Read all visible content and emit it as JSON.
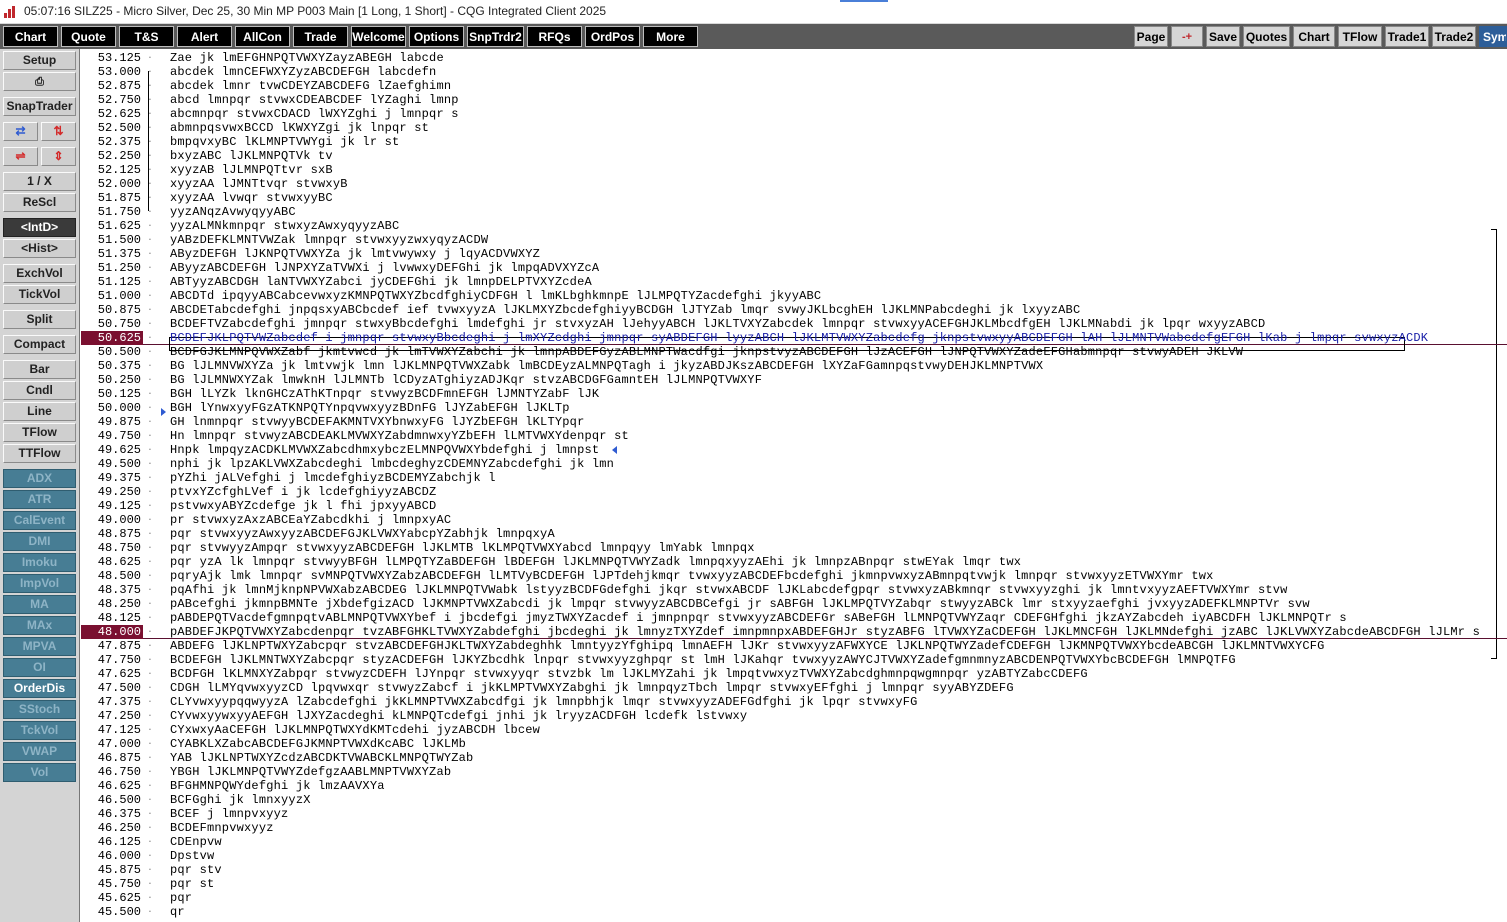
{
  "titlebar": {
    "title": "05:07:16   SILZ25 - Micro Silver, Dec 25, 30 Min MP   P003 Main   [1 Long, 1 Short] - CQG Integrated Client 2025"
  },
  "toolbar": {
    "left": [
      "Chart",
      "Quote",
      "T&S",
      "Alert",
      "AllCon",
      "Trade",
      "Welcome",
      "Options",
      "SnpTrdr2",
      "RFQs",
      "OrdPos",
      "More"
    ],
    "right": [
      "Page",
      "-+",
      "Save",
      "Quotes",
      "Chart",
      "TFlow",
      "Trade1",
      "Trade2",
      "Sym"
    ]
  },
  "sidebar": {
    "setup": "Setup",
    "print_icon": "printer-icon",
    "snaptrader": "SnapTrader",
    "one_over_x": "1 / X",
    "rescl": "ReScl",
    "intd": "<IntD>",
    "hist": "<Hist>",
    "exchvol": "ExchVol",
    "tickvol": "TickVol",
    "split": "Split",
    "compact": "Compact",
    "bar": "Bar",
    "cndl": "Cndl",
    "line": "Line",
    "tflow": "TFlow",
    "ttflow": "TTFlow",
    "studies": [
      "ADX",
      "ATR",
      "CalEvent",
      "DMI",
      "Imoku",
      "ImpVol",
      "MA",
      "MAx",
      "MPVA",
      "OI",
      "OrderDis",
      "SStoch",
      "TckVol",
      "VWAP",
      "Vol"
    ],
    "active_study": "OrderDis"
  },
  "colors": {
    "toolbar_bg": "#5a5a5a",
    "highlight_price": "#7a1030",
    "profile_blue": "#1a20a8",
    "study_teal": "#477d94"
  },
  "ladder": {
    "highlighted_prices": [
      "50.625",
      "48.000"
    ],
    "rows": [
      {
        "p": "53.125",
        "t": "Zae jk lmEFGHNPQTVWXYZayzABEGH labcde"
      },
      {
        "p": "53.000",
        "t": "abcdek lmnCEFWXYZyzABCDEFGH labcdefn"
      },
      {
        "p": "52.875",
        "t": "abcdek lmnr tvwCDEYZABCDEFG lZaefghimn"
      },
      {
        "p": "52.750",
        "t": "abcd lmnpqr stvwxCDEABCDEF lYZaghi lmnp"
      },
      {
        "p": "52.625",
        "t": "abcmnpqr stvwxCDACD lWXYZghi j lmnpqr s"
      },
      {
        "p": "52.500",
        "t": "abmnpqsvwxBCCD lKWXYZgi jk lnpqr st"
      },
      {
        "p": "52.375",
        "t": "bmpqvxyBC lKLMNPTVWYgi jk lr st"
      },
      {
        "p": "52.250",
        "t": "bxyzABC lJKLMNPQTVk tv"
      },
      {
        "p": "52.125",
        "t": "xyyzAB lJLMNPQTtvr sxB"
      },
      {
        "p": "52.000",
        "t": "xyyzAA lJMNTtvqr stvwxyB"
      },
      {
        "p": "51.875",
        "t": "xyyzAA lvwqr stvwxyyBC"
      },
      {
        "p": "51.750",
        "t": "yyzANqzAvwyqyyABC"
      },
      {
        "p": "51.625",
        "t": "yyzALMNkmnpqr stwxyzAwxyqyyzABC"
      },
      {
        "p": "51.500",
        "t": "yABzDEFKLMNTVWZak lmnpqr stvwxyyzwxyqyzACDW"
      },
      {
        "p": "51.375",
        "t": "AByzDEFGH lJKNPQTVWXYZa jk lmtvwywxy j lqyACDVWXYZ"
      },
      {
        "p": "51.250",
        "t": "AByyzABCDEFGH lJNPXYZaTVWXi j lvwwxyDEFGhi jk lmpqADVXYZcA"
      },
      {
        "p": "51.125",
        "t": "ABTyyzABCDGH laNTVWXYZabci jyCDEFGhi jk lmnpDELPTVXYZcdeA"
      },
      {
        "p": "51.000",
        "t": "ABCDTd ipqyyABCabcevwxyzKMNPQTWXYZbcdfghiyCDFGH l lmKLbghkmnpE lJLMPQTYZacdefghi jkyyABC"
      },
      {
        "p": "50.875",
        "t": "ABCDETabcdefghi jnpqsxyABCbcdef ief tvwxyyzA lJKLMXYZbcdefghiyyBCDGH lJTYZab lmqr svwyJKLbcghEH lJKLMNPabcdeghi jk lxyyzABC"
      },
      {
        "p": "50.750",
        "t": "BCDEFTVZabcdefghi jmnpqr stwxyBbcdefghi lmdefghi jr stvxyzAH lJehyyABCH lJKLTVXYZabcdek lmnpqr stvwxyyACEFGHJKLMbcdfgEH lJKLMNabdi jk lpqr wxyyzABCD"
      },
      {
        "p": "50.625",
        "t": "BCDEFJKLPQTVWZabcdef i jmnpqr stvwxyBbcdeghi j lmXYZcdghi jmnpqr syABDEFGH lyyzABCH lJKLMTVWXYZabcdefg jknpstvwxyyABCDEFGH lAH lJLMNTVWabcdefgEFGH lKab j lmpqr svwxyzACDK",
        "blue": true
      },
      {
        "p": "50.500",
        "t": "BCDFGJKLMNPQVWXZabf jkmtvwcd jk lmTVWXYZabchi jk lmnpABDEFGyzABLMNPTWacdfgi jknpstvyzABCDEFGH lJzACEFGH lJNPQTVWXYZadeEFGHabmnpqr stvwyADEH JKLVW"
      },
      {
        "p": "50.375",
        "t": "BG lJLMNVWXYZa jk lmtvwjk lmn lJKLMNPQTVWXZabk lmBCDEyzALMNPQTagh i jkyzABDJKszABCDEFGH lXYZaFGamnpqstvwyDEHJKLMNPTVWX"
      },
      {
        "p": "50.250",
        "t": "BG lJLMNWXYZak lmwknH lJLMNTb lCDyzATghiyzADJKqr stvzABCDGFGamntEH lJLMNPQTVWXYF"
      },
      {
        "p": "50.125",
        "t": "BGH lLYZk lknGHCzAThKTnpqr stvwyzBCDFmnEFGH lJMNTYZabF lJK"
      },
      {
        "p": "50.000",
        "t": "BGH lYnwxyyFGzATKNPQTYnpqvwxyyzBDnFG lJYZabEFGH lJKLTp"
      },
      {
        "p": "49.875",
        "t": "GH lnmnpqr stvwyyBCDEFAKMNTVXYbnwxyFG lJYZbEFGH lKLTYpqr"
      },
      {
        "p": "49.750",
        "t": "Hn lmnpqr stvwyzABCDEAKLMVWXYZabdmnwxyYZbEFH lLMTVWXYdenpqr st"
      },
      {
        "p": "49.625",
        "t": "Hnpk lmpqyzACDKLMVWXZabcdhmxybczELMNPQVWXYbdefghi j lmnpst"
      },
      {
        "p": "49.500",
        "t": "nphi jk lpzAKLVWXZabcdeghi lmbcdeghyzCDEMNYZabcdefghi jk lmn"
      },
      {
        "p": "49.375",
        "t": "pYZhi jALVefghi j lmcdefghiyzBCDEMYZabchjk l"
      },
      {
        "p": "49.250",
        "t": "ptvxYZcfghLVef i jk lcdefghiyyzABCDZ"
      },
      {
        "p": "49.125",
        "t": "pstvwxyABYZcdefge jk l fhi jpxyyABCD"
      },
      {
        "p": "49.000",
        "t": "pr stvwxyzAxzABCEaYZabcdkhi j lmnpxyAC"
      },
      {
        "p": "48.875",
        "t": "pqr stvwxyyzAwxyyzABCDEFGJKLVWXYabcpYZabhjk lmnpqxyA"
      },
      {
        "p": "48.750",
        "t": "pqr stvwyyzAmpqr stvwxyyzABCDEFGH lJKLMTB lKLMPQTVWXYabcd lmnpqyy lmYabk lmnpqx"
      },
      {
        "p": "48.625",
        "t": "pqr yzA lk lmnpqr stvwyyBFGH lLMPQTYZaBDEFGH lBDEFGH lJKLMNPQTVWYZadk lmnpqxyyzAEhi jk lmnpzABnpqr stwEYak lmqr twx"
      },
      {
        "p": "48.500",
        "t": "pqryAjk lmk lmnpqr svMNPQTVWXYZabzABCDEFGH lLMTVyBCDEFGH lJPTdehjkmqr tvwxyyzABCDEFbcdefghi jkmnpvwxyzABmnpqtvwjk lmnpqr stvwxyyzETVWXYmr twx"
      },
      {
        "p": "48.375",
        "t": "pqAfhi jk lmnMjknpNPVWXabzABCDEG lJKLMNPQTVWabk lstyyzBCDFGdefghi jkqr stvwxABCDF lJKLabcdefgpqr stvwxyzABkmnqr stvwxyyzghi jk lmntvxyyzAEFTVWXYmr stvw"
      },
      {
        "p": "48.250",
        "t": "pABcefghi jkmnpBMNTe jXbdefgizACD lJKMNPTVWXZabcdi jk lmpqr stvwyyzABCDBCefgi jr sABFGH lJKLMPQTVYZabqr stwyyzABCk lmr stxyyzaefghi jvxyyzADEFKLMNPTVr svw"
      },
      {
        "p": "48.125",
        "t": "pABDEPQTVacdefgmnpqtvABLMNPQTVWXYbef i jbcdefgi jmyzTWXYZacdef i jmnpnpqr stvwxyyzABCDEFGr sABeFGH lLMNPQTVWYZaqr CDEFGHfghi jkzAYZabcdeh iyABCDFH lJKLMNPQTr s"
      },
      {
        "p": "48.000",
        "t": "pABDEFJKPQTVWXYZabcdenpqr tvzABFGHKLTVWXYZabdefghi jbcdeghi jk lmnyzTXYZdef imnpmnpxABDEFGHJr styzABFG lTVWXYZaCDEFGH lJKLMNCFGH lJKLMNdefghi jzABC lJKLVWXYZabcdeABCDFGH lJLMr s"
      },
      {
        "p": "47.875",
        "t": "ABDEFG lJKLNPTWXYZabcpqr stvzABCDEFGHJKLTWXYZabdeghhk lmntyyzYfghipq lmnAEFH lJKr stvwxyyzAFWXYCE lJKLNPQTWYZadefCDEFGH lJKMNPQTVWXYbcdeABCGH lJKLMNTVWXYCFG"
      },
      {
        "p": "47.750",
        "t": "BCDEFGH lJKLMNTWXYZabcpqr styzACDEFGH lJKYZbcdhk lnpqr stvwxyyzghpqr st lmH lJKahqr tvwxyyzAWYCJTVWXYZadefgmnmnyzABCDENPQTVWXYbcBCDEFGH lMNPQTFG"
      },
      {
        "p": "47.625",
        "t": "BCDFGH lKLMNXYZabpqr stvwyzCDEFH lJYnpqr stvwxyyqr stvzbk lm lJKLMYZahi jk lmpqtvwxyzTVWXYZabcdghmnpqwgmnpqr yzABTYZabcCDEFG"
      },
      {
        "p": "47.500",
        "t": "CDGH lLMYqvwxyyzCD lpqvwxqr stvwyzZabcf i jkKLMPTVWXYZabghi jk lmnpqyzTbch lmpqr stvwxyEFfghi j lmnpqr syyABYZDEFG"
      },
      {
        "p": "47.375",
        "t": "CLYvwxyypqqwyyzA lZabcdefghi jkKLMNPTVWXZabcdfgi jk lmnpbhjk lmqr stvwxyyzADEFGdfghi jk lpqr stvwxyFG"
      },
      {
        "p": "47.250",
        "t": "CYvwxyywxyyAEFGH lJXYZacdeghi kLMNPQTcdefgi jnhi jk lryyzACDFGH lcdefk lstvwxy"
      },
      {
        "p": "47.125",
        "t": "CYxwxyAaCEFGH lJKLMNPQTWXYdKMTcdehi jyzABCDH lbcew"
      },
      {
        "p": "47.000",
        "t": "CYABKLXZabcABCDEFGJKMNPTVWXdKcABC lJKLMb"
      },
      {
        "p": "46.875",
        "t": "YAB lJKLNPTWXYZcdzABCDKTVWABCKLMNPQTWYZab"
      },
      {
        "p": "46.750",
        "t": "YBGH lJKLMNPQTVWYZdefgzAABLMNPTVWXYZab"
      },
      {
        "p": "46.625",
        "t": "BFGHMNPQWYdefghi jk lmzAAVXYa"
      },
      {
        "p": "46.500",
        "t": "BCFGghi jk lmnxyyzX"
      },
      {
        "p": "46.375",
        "t": "BCEF j lmnpvxyyz"
      },
      {
        "p": "46.250",
        "t": "BCDEFmnpvwxyyz"
      },
      {
        "p": "46.125",
        "t": "CDEnpvw"
      },
      {
        "p": "46.000",
        "t": "Dpstvw"
      },
      {
        "p": "45.875",
        "t": "pqr stv"
      },
      {
        "p": "45.750",
        "t": "pqr st"
      },
      {
        "p": "45.625",
        "t": "pqr"
      },
      {
        "p": "45.500",
        "t": "qr"
      }
    ]
  }
}
